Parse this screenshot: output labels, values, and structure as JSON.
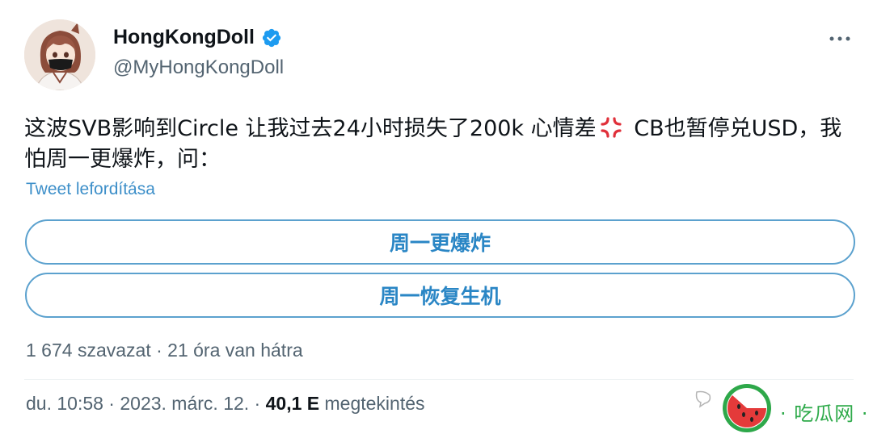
{
  "author": {
    "display_name": "HongKongDoll",
    "handle": "@MyHongKongDoll",
    "verified": true
  },
  "icons": {
    "avatar": "avatar-image",
    "verified": "verified-badge-icon",
    "more": "more-options-icon",
    "emoji": "anger-symbol-emoji"
  },
  "tweet": {
    "text_part1": "这波SVB影响到Circle 让我过去24小时损失了200k 心情差",
    "text_part2": " CB也暂停兑USD，我怕周一更爆炸，问：",
    "translate_link": "Tweet lefordítása"
  },
  "poll": {
    "options": [
      {
        "label": "周一更爆炸"
      },
      {
        "label": "周一恢复生机"
      }
    ],
    "meta": "1 674 szavazat · 21 óra van hátra"
  },
  "footer": {
    "timestamp": "du. 10:58 · 2023. márc. 12. · ",
    "views_count": "40,1 E",
    "views_label": " megtekintés"
  },
  "watermark": {
    "text": "· 吃瓜网 ·"
  },
  "colors": {
    "accent": "#2a86c5",
    "verified": "#1d9bf0",
    "secondary_text": "#536471"
  }
}
